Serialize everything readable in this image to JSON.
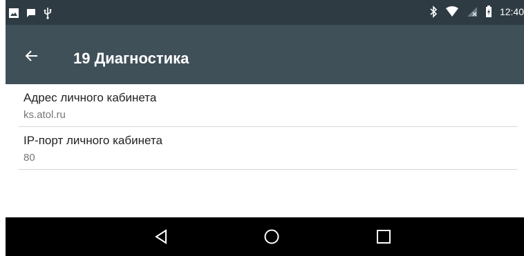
{
  "status_bar": {
    "time": "12:40",
    "left_icons": [
      "gallery-icon",
      "chat-bubble-icon",
      "usb-icon"
    ],
    "right_icons": [
      "bluetooth-icon",
      "wifi-icon",
      "no-signal-icon",
      "battery-charging-icon"
    ]
  },
  "app_bar": {
    "title": "19 Диагностика",
    "back_icon": "arrow-back-icon",
    "background": "#3f5059"
  },
  "settings": [
    {
      "title": "Адрес личного кабинета",
      "value": "ks.atol.ru"
    },
    {
      "title": "IP-порт личного кабинета",
      "value": "80"
    }
  ],
  "nav_bar": {
    "buttons": [
      "back-triangle-icon",
      "home-circle-icon",
      "recents-square-icon"
    ]
  }
}
